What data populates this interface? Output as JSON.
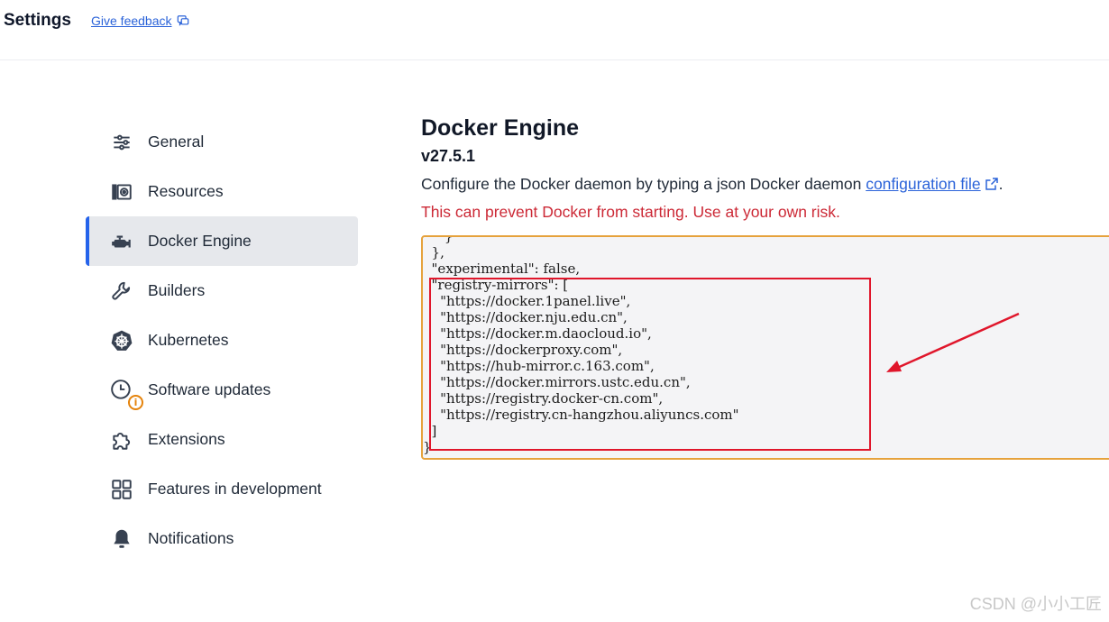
{
  "header": {
    "title": "Settings",
    "feedback_label": "Give feedback"
  },
  "sidebar": {
    "items": [
      {
        "label": "General",
        "icon": "sliders-icon"
      },
      {
        "label": "Resources",
        "icon": "resources-icon"
      },
      {
        "label": "Docker Engine",
        "icon": "docker-engine-icon",
        "active": true
      },
      {
        "label": "Builders",
        "icon": "wrench-icon"
      },
      {
        "label": "Kubernetes",
        "icon": "kubernetes-helm-icon"
      },
      {
        "label": "Software updates",
        "icon": "clock-icon",
        "badge": "i"
      },
      {
        "label": "Extensions",
        "icon": "puzzle-icon"
      },
      {
        "label": "Features in development",
        "icon": "grid-icon"
      },
      {
        "label": "Notifications",
        "icon": "bell-icon"
      }
    ]
  },
  "main": {
    "title": "Docker Engine",
    "version": "v27.5.1",
    "description_prefix": "Configure the Docker daemon by typing a json Docker daemon ",
    "description_link": "configuration file",
    "description_suffix": ".",
    "warning": "This can prevent Docker from starting. Use at your own risk."
  },
  "editor": {
    "lines": [
      "     }",
      "  },",
      "  \"experimental\": false,",
      "  \"registry-mirrors\": [",
      "    \"https://docker.1panel.live\",",
      "    \"https://docker.nju.edu.cn\",",
      "    \"https://docker.m.daocloud.io\",",
      "    \"https://dockerproxy.com\",",
      "    \"https://hub-mirror.c.163.com\",",
      "    \"https://docker.mirrors.ustc.edu.cn\",",
      "    \"https://registry.docker-cn.com\",",
      "    \"https://registry.cn-hangzhou.aliyuncs.com\"",
      "  ]",
      "}"
    ]
  },
  "colors": {
    "accent": "#2563eb",
    "link": "#2b63d9",
    "warning": "#cc2936",
    "editor_border": "#e6a23c",
    "annotation": "#e0162b"
  },
  "watermark": "CSDN @小小工匠"
}
